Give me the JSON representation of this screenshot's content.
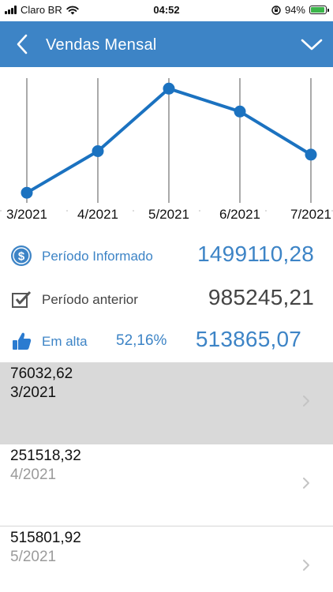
{
  "status_bar": {
    "carrier": "Claro BR",
    "time": "04:52",
    "battery": "94%",
    "battery_level": 0.94
  },
  "header": {
    "title": "Vendas Mensal",
    "back_icon": "chevron-left-icon",
    "menu_icon": "chevron-down-icon"
  },
  "chart_data": {
    "type": "line",
    "categories": [
      "3/2021",
      "4/2021",
      "5/2021",
      "6/2021",
      "7/2021"
    ],
    "values": [
      76032.62,
      251518.32,
      515801.92,
      419000,
      237000
    ],
    "ylim": [
      40000,
      560000
    ],
    "grid": "vertical",
    "color": "#1b72c0"
  },
  "summary": {
    "informado": {
      "label": "Período Informado",
      "value": "1499110,28",
      "icon": "dollar-coin-icon"
    },
    "anterior": {
      "label": "Período anterior",
      "value": "985245,21",
      "icon": "checkbox-icon"
    },
    "alta": {
      "label": "Em alta",
      "percent": "52,16%",
      "value": "513865,07",
      "icon": "thumbs-up-icon"
    }
  },
  "list": [
    {
      "amount": "76032,62",
      "period": "3/2021"
    },
    {
      "amount": "251518,32",
      "period": "4/2021"
    },
    {
      "amount": "515801,92",
      "period": "5/2021"
    }
  ],
  "colors": {
    "header": "#3d84c6",
    "accent": "#3d84c6",
    "line": "#1b72c0",
    "selected_row": "#d9d9d9"
  }
}
